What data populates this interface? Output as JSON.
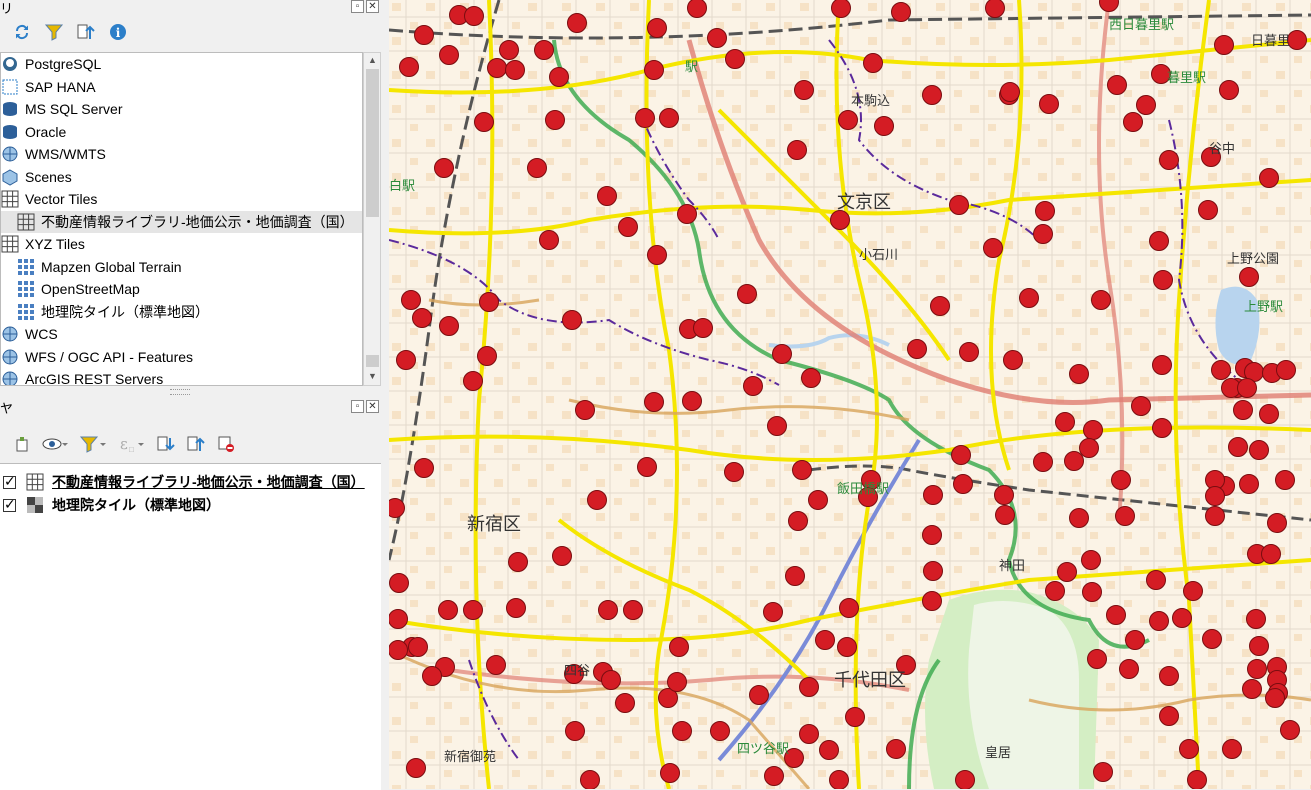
{
  "browser_panel": {
    "title": "ブラウザ",
    "title_visible": "リ",
    "items": [
      {
        "label": "PostgreSQL",
        "icon": "elephant-icon"
      },
      {
        "label": "SAP HANA",
        "icon": "hana-icon"
      },
      {
        "label": "MS SQL Server",
        "icon": "database-icon"
      },
      {
        "label": "Oracle",
        "icon": "database-icon"
      },
      {
        "label": "WMS/WMTS",
        "icon": "globe-icon"
      },
      {
        "label": "Scenes",
        "icon": "cube-icon"
      },
      {
        "label": "Vector Tiles",
        "icon": "grid-icon"
      },
      {
        "label": "不動産情報ライブラリ-地価公示・地価調査（国）",
        "icon": "grid-icon"
      },
      {
        "label": "XYZ Tiles",
        "icon": "grid-icon"
      },
      {
        "label": "Mapzen Global Terrain",
        "icon": "raster-grid-icon"
      },
      {
        "label": "OpenStreetMap",
        "icon": "raster-grid-icon"
      },
      {
        "label": "地理院タイル（標準地図）",
        "icon": "raster-grid-icon"
      },
      {
        "label": "WCS",
        "icon": "globe-icon"
      },
      {
        "label": "WFS / OGC API - Features",
        "icon": "globe-icon"
      },
      {
        "label": "ArcGIS REST Servers",
        "icon": "globe-icon"
      }
    ]
  },
  "layers_panel": {
    "title_visible": "ヤ",
    "layers": [
      {
        "label": "不動産情報ライブラリ-地価公示・地価調査（国）",
        "checked": true
      },
      {
        "label": "地理院タイル（標準地図）",
        "checked": true
      }
    ]
  },
  "map": {
    "labels": [
      "文京区",
      "小石川",
      "本駒込",
      "新宿区",
      "千代田区",
      "四谷",
      "神田",
      "上野公園",
      "上野駅",
      "西日暮里駅",
      "日暮里",
      "飯田橋駅",
      "四ツ谷駅",
      "皇居",
      "新宿御苑",
      "白駅",
      "駅",
      "谷中",
      "暮里駅"
    ],
    "colors": {
      "marker": "#d41c24",
      "primary_road": "#f5e600",
      "expressway": "#36a84a",
      "rail": "#e07d72",
      "water": "#b8d4ee",
      "park": "#d4eec4"
    }
  }
}
